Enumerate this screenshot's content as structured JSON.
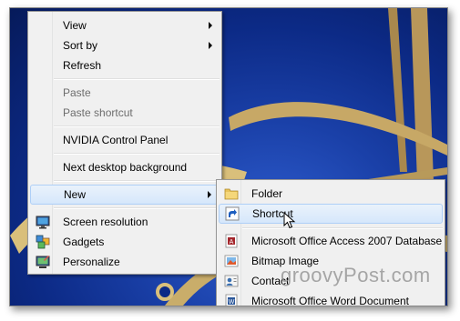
{
  "context_menu": {
    "items": [
      {
        "label": "View"
      },
      {
        "label": "Sort by"
      },
      {
        "label": "Refresh"
      },
      {
        "label": "Paste"
      },
      {
        "label": "Paste shortcut"
      },
      {
        "label": "NVIDIA Control Panel"
      },
      {
        "label": "Next desktop background"
      },
      {
        "label": "New"
      },
      {
        "label": "Screen resolution"
      },
      {
        "label": "Gadgets"
      },
      {
        "label": "Personalize"
      }
    ]
  },
  "new_submenu": {
    "items": [
      {
        "label": "Folder"
      },
      {
        "label": "Shortcut"
      },
      {
        "label": "Microsoft Office Access 2007 Database"
      },
      {
        "label": "Bitmap Image"
      },
      {
        "label": "Contact"
      },
      {
        "label": "Microsoft Office Word Document"
      }
    ]
  },
  "watermark": "groovyPost.com",
  "colors": {
    "hover_bg": "#d6e7fb",
    "hover_border": "#aecff7",
    "menu_bg": "#f0f0f0",
    "disabled_text": "#6d6d6d"
  }
}
